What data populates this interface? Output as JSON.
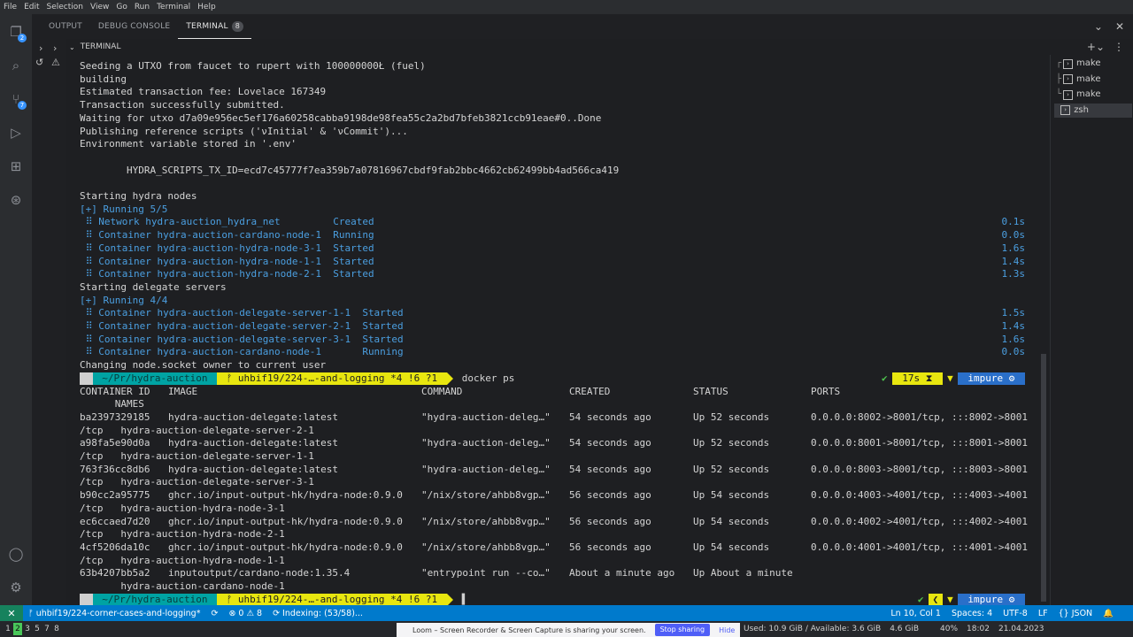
{
  "menubar": [
    "File",
    "Edit",
    "Selection",
    "View",
    "Go",
    "Run",
    "Terminal",
    "Help"
  ],
  "activity": {
    "explorer_badge": "2",
    "scm_badge": "7"
  },
  "panel": {
    "tabs": [
      {
        "label": "OUTPUT"
      },
      {
        "label": "DEBUG CONSOLE"
      },
      {
        "label": "TERMINAL",
        "count": "8"
      }
    ],
    "terminal_title": "TERMINAL"
  },
  "terminal": {
    "lines": [
      "Seeding a UTXO from faucet to rupert with 100000000Ł (fuel)",
      "building",
      "Estimated transaction fee: Lovelace 167349",
      "Transaction successfully submitted.",
      "Waiting for utxo d7a09e956ec5ef176a60258cabba9198de98fea55c2a2bd7bfeb3821ccb91eae#0..Done",
      "Publishing reference scripts ('νInitial' & 'νCommit')...",
      "Environment variable stored in '.env'",
      "",
      "        HYDRA_SCRIPTS_TX_ID=ecd7c45777f7ea359b7a07816967cbdf9fab2bbc4662cb62499bb4ad566ca419",
      "",
      "Starting hydra nodes"
    ],
    "running1": "[+] Running 5/5",
    "group1": [
      {
        "text": " ⠿ Network hydra-auction_hydra_net         Created",
        "time": "0.1s"
      },
      {
        "text": " ⠿ Container hydra-auction-cardano-node-1  Running",
        "time": "0.0s"
      },
      {
        "text": " ⠿ Container hydra-auction-hydra-node-3-1  Started",
        "time": "1.6s"
      },
      {
        "text": " ⠿ Container hydra-auction-hydra-node-1-1  Started",
        "time": "1.4s"
      },
      {
        "text": " ⠿ Container hydra-auction-hydra-node-2-1  Started",
        "time": "1.3s"
      }
    ],
    "starting_delegate": "Starting delegate servers",
    "running2": "[+] Running 4/4",
    "group2": [
      {
        "text": " ⠿ Container hydra-auction-delegate-server-1-1  Started",
        "time": "1.5s"
      },
      {
        "text": " ⠿ Container hydra-auction-delegate-server-2-1  Started",
        "time": "1.4s"
      },
      {
        "text": " ⠿ Container hydra-auction-delegate-server-3-1  Started",
        "time": "1.6s"
      },
      {
        "text": " ⠿ Container hydra-auction-cardano-node-1       Running",
        "time": "0.0s"
      }
    ],
    "changing_owner": "Changing node.socket owner to current user",
    "prompt": {
      "os": " ",
      "path": " ~/Pr/hydra-auction ",
      "git": " ᚠ uhbif19/224-…-and-logging *4 !6 ?1 ",
      "cmd": "docker ps",
      "check": "✔",
      "duration": " 17s ⧗ ",
      "arrow": "▼",
      "env": " impure ⚙ "
    },
    "ps_header": {
      "container_id": "CONTAINER ID",
      "image": "IMAGE",
      "command": "COMMAND",
      "created": "CREATED",
      "status": "STATUS",
      "ports": "PORTS",
      "names": "      NAMES"
    },
    "ps_rows": [
      {
        "id": "ba2397329185",
        "image": "hydra-auction-delegate:latest",
        "command": "\"hydra-auction-deleg…\"",
        "created": "54 seconds ago",
        "status": "Up 52 seconds",
        "ports": "0.0.0.0:8002->8001/tcp, :::8002->8001",
        "cont": "/tcp   hydra-auction-delegate-server-2-1"
      },
      {
        "id": "a98fa5e90d0a",
        "image": "hydra-auction-delegate:latest",
        "command": "\"hydra-auction-deleg…\"",
        "created": "54 seconds ago",
        "status": "Up 52 seconds",
        "ports": "0.0.0.0:8001->8001/tcp, :::8001->8001",
        "cont": "/tcp   hydra-auction-delegate-server-1-1"
      },
      {
        "id": "763f36cc8db6",
        "image": "hydra-auction-delegate:latest",
        "command": "\"hydra-auction-deleg…\"",
        "created": "54 seconds ago",
        "status": "Up 52 seconds",
        "ports": "0.0.0.0:8003->8001/tcp, :::8003->8001",
        "cont": "/tcp   hydra-auction-delegate-server-3-1"
      },
      {
        "id": "b90cc2a95775",
        "image": "ghcr.io/input-output-hk/hydra-node:0.9.0",
        "command": "\"/nix/store/ahbb8vgp…\"",
        "created": "56 seconds ago",
        "status": "Up 54 seconds",
        "ports": "0.0.0.0:4003->4001/tcp, :::4003->4001",
        "cont": "/tcp   hydra-auction-hydra-node-3-1"
      },
      {
        "id": "ec6ccaed7d20",
        "image": "ghcr.io/input-output-hk/hydra-node:0.9.0",
        "command": "\"/nix/store/ahbb8vgp…\"",
        "created": "56 seconds ago",
        "status": "Up 54 seconds",
        "ports": "0.0.0.0:4002->4001/tcp, :::4002->4001",
        "cont": "/tcp   hydra-auction-hydra-node-2-1"
      },
      {
        "id": "4cf5206da10c",
        "image": "ghcr.io/input-output-hk/hydra-node:0.9.0",
        "command": "\"/nix/store/ahbb8vgp…\"",
        "created": "56 seconds ago",
        "status": "Up 54 seconds",
        "ports": "0.0.0.0:4001->4001/tcp, :::4001->4001",
        "cont": "/tcp   hydra-auction-hydra-node-1-1"
      },
      {
        "id": "63b4207bb5a2",
        "image": "inputoutput/cardano-node:1.35.4",
        "command": "\"entrypoint run --co…\"",
        "created": "About a minute ago",
        "status": "Up About a minute",
        "ports": "",
        "cont": "       hydra-auction-cardano-node-1"
      }
    ],
    "prompt2": {
      "check": "✔",
      "env": " impure ⚙ "
    }
  },
  "sidelist": [
    {
      "label": "make",
      "prefix": "┌"
    },
    {
      "label": "make",
      "prefix": "├"
    },
    {
      "label": "make",
      "prefix": "└"
    },
    {
      "label": "zsh",
      "prefix": " "
    }
  ],
  "statusbar": {
    "remote": "✕",
    "branch": "ᚠ uhbif19/224-corner-cases-and-logging*",
    "sync": "⟳",
    "problems": "⊗ 0 ⚠ 8",
    "indexing": "⟳ Indexing: (53/58)...",
    "position": "Ln 10, Col 1",
    "spaces": "Spaces: 4",
    "encoding": "UTF-8",
    "eol": "LF",
    "language": "{} JSON",
    "bell": "🔔"
  },
  "taskbar": {
    "workspaces": [
      "1",
      "2",
      "3",
      "5",
      "7",
      "8"
    ],
    "active_workspace": "2",
    "loom_text": "Loom – Screen Recorder & Screen Capture is sharing your screen.",
    "loom_stop": "Stop sharing",
    "loom_hide": "Hide",
    "disk": "Used: 10.9 GiB / Available: 3.6 GiB",
    "mem": "4.6 GiB",
    "battery": "40%",
    "time": "18:02",
    "date": "21.04.2023"
  }
}
